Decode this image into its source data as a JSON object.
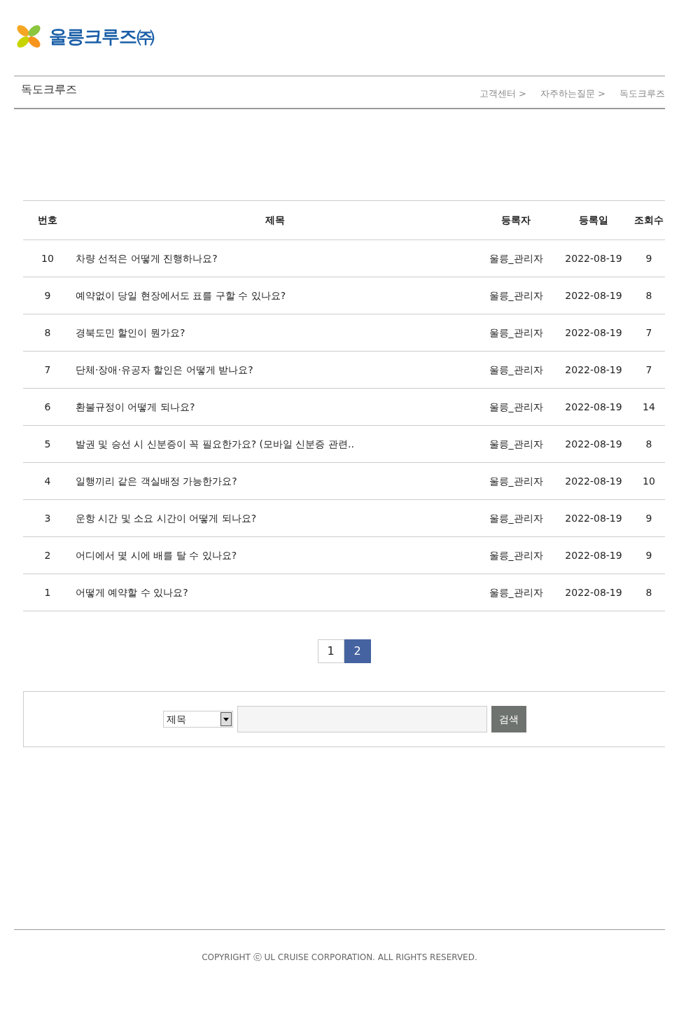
{
  "logo": {
    "text": "울릉크루즈",
    "suffix": "㈜"
  },
  "page_title": "독도크루즈",
  "breadcrumb": [
    {
      "label": "고객센터 >"
    },
    {
      "label": "자주하는질문 >"
    },
    {
      "label": "독도크루즈"
    }
  ],
  "table": {
    "columns": [
      "번호",
      "제목",
      "등록자",
      "등록일",
      "조회수"
    ],
    "rows": [
      [
        "10",
        "차량 선적은 어떻게 진행하나요?",
        "울릉_관리자",
        "2022-08-19",
        "9"
      ],
      [
        "9",
        "예약없이 당일 현장에서도 표를 구할 수 있나요?",
        "울릉_관리자",
        "2022-08-19",
        "8"
      ],
      [
        "8",
        "경북도민 할인이 뭔가요?",
        "울릉_관리자",
        "2022-08-19",
        "7"
      ],
      [
        "7",
        "단체·장애·유공자 할인은 어떻게 받나요?",
        "울릉_관리자",
        "2022-08-19",
        "7"
      ],
      [
        "6",
        "환불규정이 어떻게 되나요?",
        "울릉_관리자",
        "2022-08-19",
        "14"
      ],
      [
        "5",
        "발권 및 승선 시 신분증이 꼭 필요한가요? (모바일 신분증 관련..",
        "울릉_관리자",
        "2022-08-19",
        "8"
      ],
      [
        "4",
        "일행끼리 같은 객실배정 가능한가요?",
        "울릉_관리자",
        "2022-08-19",
        "10"
      ],
      [
        "3",
        "운항 시간 및 소요 시간이 어떻게 되나요?",
        "울릉_관리자",
        "2022-08-19",
        "9"
      ],
      [
        "2",
        "어디에서 몇 시에 배를 탈 수 있나요?",
        "울릉_관리자",
        "2022-08-19",
        "9"
      ],
      [
        "1",
        "어떻게 예약할 수 있나요?",
        "울릉_관리자",
        "2022-08-19",
        "8"
      ]
    ]
  },
  "pagination": [
    {
      "label": "1",
      "selected": false
    },
    {
      "label": "2",
      "selected": true
    }
  ],
  "search": {
    "field": "제목",
    "button": "검색"
  },
  "footer": "COPYRIGHT ⓒ UL CRUISE CORPORATION. ALL RIGHTS RESERVED."
}
